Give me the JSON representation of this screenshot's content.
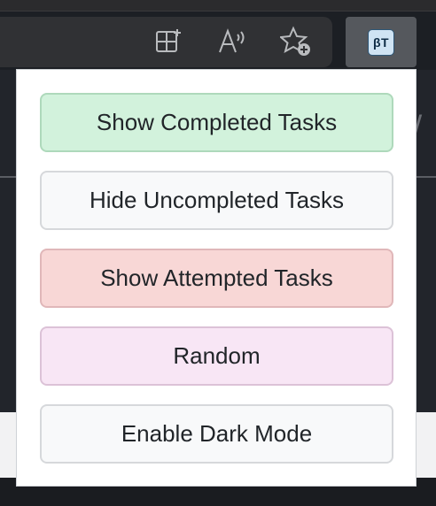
{
  "extension": {
    "badge_text": "βT"
  },
  "toolbar": {
    "icons": [
      "split-screen-icon",
      "read-aloud-icon",
      "add-favorite-icon"
    ]
  },
  "page": {
    "side_text": "W"
  },
  "popup": {
    "buttons": {
      "show_completed": "Show Completed Tasks",
      "hide_uncompleted": "Hide Uncompleted Tasks",
      "show_attempted": "Show Attempted Tasks",
      "random": "Random",
      "enable_dark_mode": "Enable Dark Mode"
    }
  },
  "colors": {
    "completed_bg": "#d2f2dc",
    "attempted_bg": "#f8d7d6",
    "random_bg": "#f8e6f5",
    "neutral_bg": "#f8f9fa",
    "text": "#212529"
  }
}
